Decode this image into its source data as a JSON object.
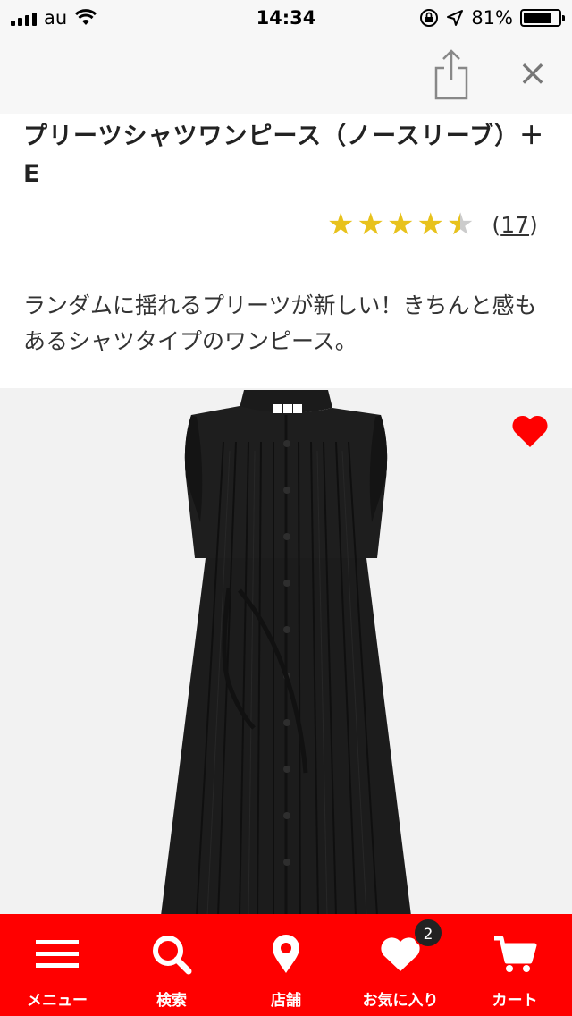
{
  "status_bar": {
    "carrier": "au",
    "time": "14:34",
    "battery_percent": "81%",
    "battery_level": 0.81
  },
  "nav": {
    "share_icon": "share-icon",
    "close_label": "×"
  },
  "product": {
    "title": "プリーツシャツワンピース（ノースリーブ）＋E",
    "rating": 4.5,
    "rating_max": 5,
    "review_count_open": "(",
    "review_count": "17",
    "review_count_close": ")",
    "description": "ランダムに揺れるプリーツが新しい！きちんと感もあるシャツタイプのワンピース。",
    "favorite_icon": "heart-icon",
    "image_logo_text": "UNIQLO"
  },
  "tabbar": {
    "items": [
      {
        "label": "メニュー",
        "icon": "menu-icon"
      },
      {
        "label": "検索",
        "icon": "search-icon"
      },
      {
        "label": "店舗",
        "icon": "location-pin-icon"
      },
      {
        "label": "お気に入り",
        "icon": "heart-icon",
        "badge": "2"
      },
      {
        "label": "カート",
        "icon": "cart-icon"
      }
    ]
  },
  "colors": {
    "accent": "#ff0000",
    "star": "#e8c21c",
    "image_bg": "#f2f2f2"
  }
}
